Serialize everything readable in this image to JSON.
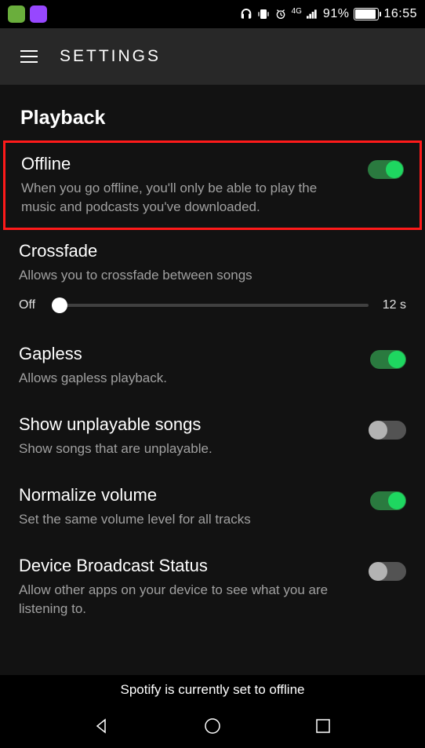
{
  "status_bar": {
    "battery_pct": "91%",
    "time": "16:55",
    "network_label": "4G"
  },
  "header": {
    "title": "SETTINGS"
  },
  "section": {
    "title": "Playback"
  },
  "settings": {
    "offline": {
      "title": "Offline",
      "desc": "When you go offline, you'll only be able to play the music and podcasts you've downloaded.",
      "on": true
    },
    "crossfade": {
      "title": "Crossfade",
      "desc": "Allows you to crossfade between songs",
      "slider_off_label": "Off",
      "slider_max_label": "12 s",
      "value": 0
    },
    "gapless": {
      "title": "Gapless",
      "desc": "Allows gapless playback.",
      "on": true
    },
    "unplayable": {
      "title": "Show unplayable songs",
      "desc": "Show songs that are unplayable.",
      "on": false
    },
    "normalize": {
      "title": "Normalize volume",
      "desc": "Set the same volume level for all tracks",
      "on": true
    },
    "broadcast": {
      "title": "Device Broadcast Status",
      "desc": "Allow other apps on your device to see what you are listening to.",
      "on": false
    }
  },
  "caption": "Spotify is currently set to offline"
}
